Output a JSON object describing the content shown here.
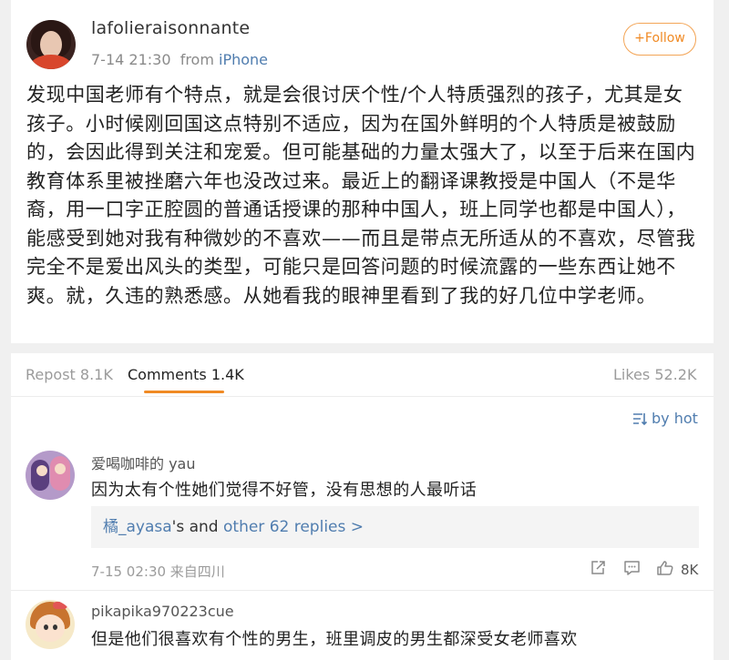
{
  "post": {
    "username": "lafolieraisonnante",
    "time": "7-14 21:30",
    "from_label": "from",
    "source": "iPhone",
    "follow_label": "+Follow",
    "text": "发现中国老师有个特点，就是会很讨厌个性/个人特质强烈的孩子，尤其是女孩子。小时候刚回国这点特别不适应，因为在国外鲜明的个人特质是被鼓励的，会因此得到关注和宠爱。但可能基础的力量太强大了，以至于后来在国内教育体系里被挫磨六年也没改过来。最近上的翻译课教授是中国人（不是华裔，用一口字正腔圆的普通话授课的那种中国人，班上同学也都是中国人），能感受到她对我有种微妙的不喜欢——而且是带点无所适从的不喜欢，尽管我完全不是爱出风头的类型，可能只是回答问题的时候流露的一些东西让她不爽。就，久违的熟悉感。从她看我的眼神里看到了我的好几位中学老师。"
  },
  "tabs": {
    "repost": "Repost 8.1K",
    "comments": "Comments 1.4K",
    "likes": "Likes 52.2K"
  },
  "sort_label": "by hot",
  "comments": [
    {
      "username": "爱喝咖啡的 yau",
      "text": "因为太有个性她们觉得不好管，没有思想的人最听话",
      "replies": {
        "user": "橘_ayasa",
        "mid": "'s and ",
        "more": "other 62 replies >"
      },
      "time": "7-15 02:30 来自四川",
      "likes": "8K"
    },
    {
      "username": "pikapika970223cue",
      "text": "但是他们很喜欢有个性的男生，班里调皮的男生都深受女老师喜欢"
    }
  ],
  "colors": {
    "link": "#507daf",
    "accent": "#f08a24"
  }
}
